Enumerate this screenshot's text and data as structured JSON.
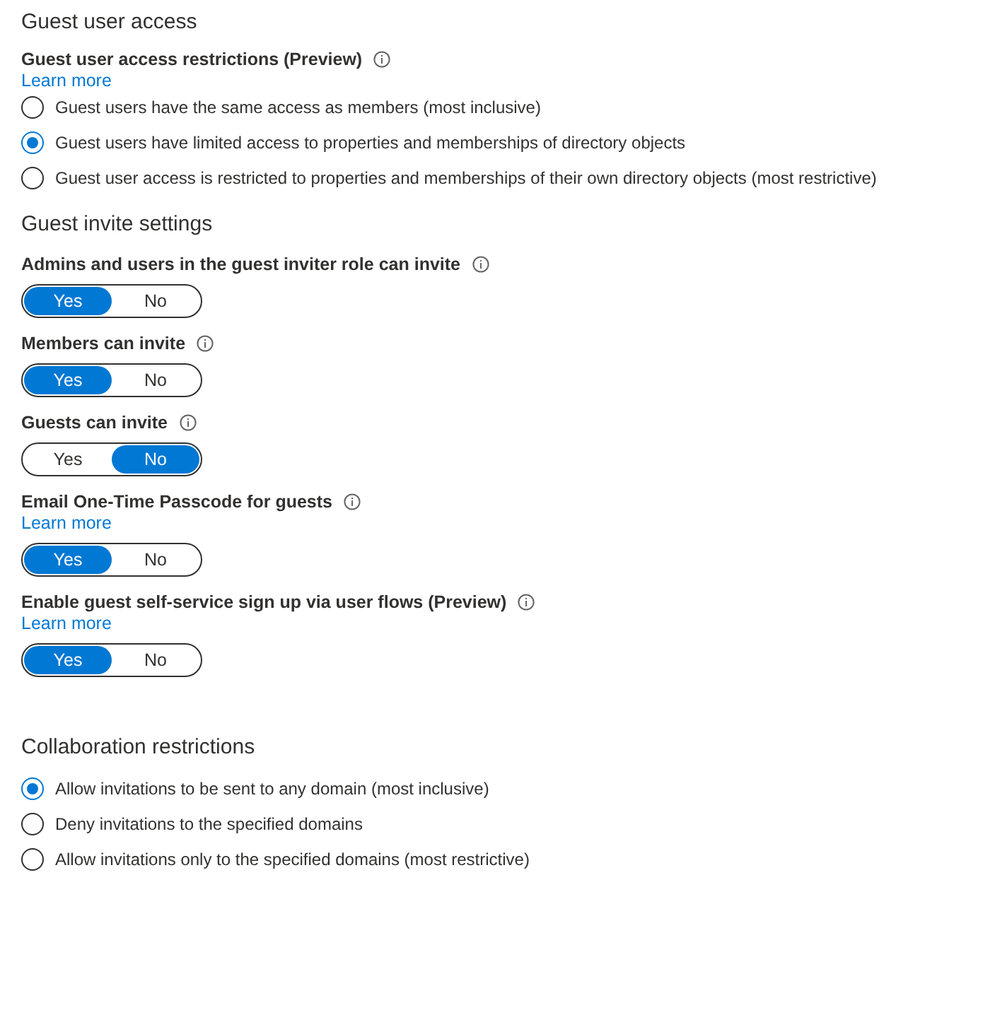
{
  "guest_user_access": {
    "title": "Guest user access",
    "label": "Guest user access restrictions (Preview)",
    "link": "Learn more",
    "options": [
      {
        "label": "Guest users have the same access as members (most inclusive)",
        "selected": false
      },
      {
        "label": "Guest users have limited access to properties and memberships of directory objects",
        "selected": true
      },
      {
        "label": "Guest user access is restricted to properties and memberships of their own directory objects (most restrictive)",
        "selected": false
      }
    ]
  },
  "guest_invite_settings": {
    "title": "Guest invite settings",
    "settings": [
      {
        "label": "Admins and users in the guest inviter role can invite",
        "options": [
          {
            "label": "Yes",
            "selected": true
          },
          {
            "label": "No",
            "selected": false
          }
        ]
      },
      {
        "label": "Members can invite",
        "options": [
          {
            "label": "Yes",
            "selected": true
          },
          {
            "label": "No",
            "selected": false
          }
        ]
      },
      {
        "label": "Guests can invite",
        "options": [
          {
            "label": "Yes",
            "selected": false
          },
          {
            "label": "No",
            "selected": true
          }
        ]
      },
      {
        "label": "Email One-Time Passcode for guests",
        "link": "Learn more",
        "options": [
          {
            "label": "Yes",
            "selected": true
          },
          {
            "label": "No",
            "selected": false
          }
        ]
      },
      {
        "label": "Enable guest self-service sign up via user flows (Preview)",
        "link": "Learn more",
        "options": [
          {
            "label": "Yes",
            "selected": true
          },
          {
            "label": "No",
            "selected": false
          }
        ]
      }
    ]
  },
  "collaboration_restrictions": {
    "title": "Collaboration restrictions",
    "options": [
      {
        "label": "Allow invitations to be sent to any domain (most inclusive)",
        "selected": true
      },
      {
        "label": "Deny invitations to the specified domains",
        "selected": false
      },
      {
        "label": "Allow invitations only to the specified domains (most restrictive)",
        "selected": false
      }
    ]
  }
}
